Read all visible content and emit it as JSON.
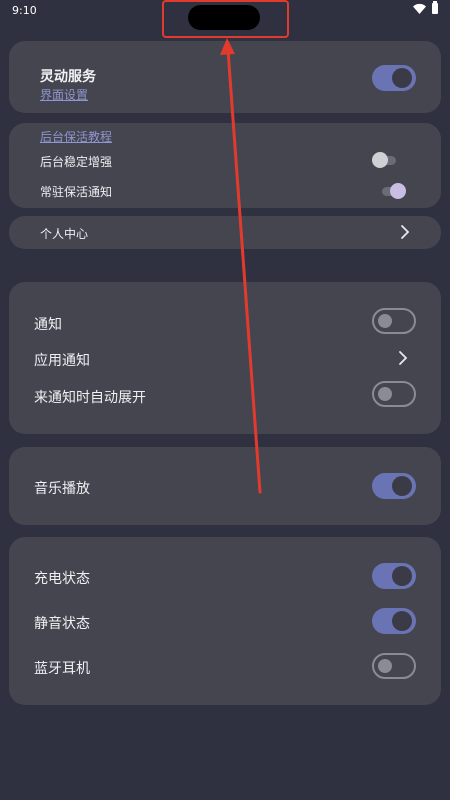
{
  "status_bar": {
    "time": "9:10"
  },
  "service_card": {
    "title": "灵动服务",
    "link": "界面设置",
    "toggle_on": true
  },
  "keepalive_card": {
    "link": "后台保活教程",
    "items": [
      {
        "label": "后台稳定增强",
        "on": false
      },
      {
        "label": "常驻保活通知",
        "on": true
      }
    ]
  },
  "profile": {
    "label": "个人中心"
  },
  "notify_card": {
    "items": [
      {
        "label": "通知",
        "type": "toggle",
        "on": false
      },
      {
        "label": "应用通知",
        "type": "chevron"
      },
      {
        "label": "来通知时自动展开",
        "type": "toggle",
        "on": false
      }
    ]
  },
  "music_card": {
    "items": [
      {
        "label": "音乐播放",
        "on": true
      }
    ]
  },
  "status_card": {
    "items": [
      {
        "label": "充电状态",
        "on": true
      },
      {
        "label": "静音状态",
        "on": true
      },
      {
        "label": "蓝牙耳机",
        "on": false
      }
    ]
  },
  "colors": {
    "background": "#2f3040",
    "card": "#44454f",
    "accent": "#6a74b4",
    "link": "#8f95ce",
    "annotation_red": "#e23b2e"
  }
}
